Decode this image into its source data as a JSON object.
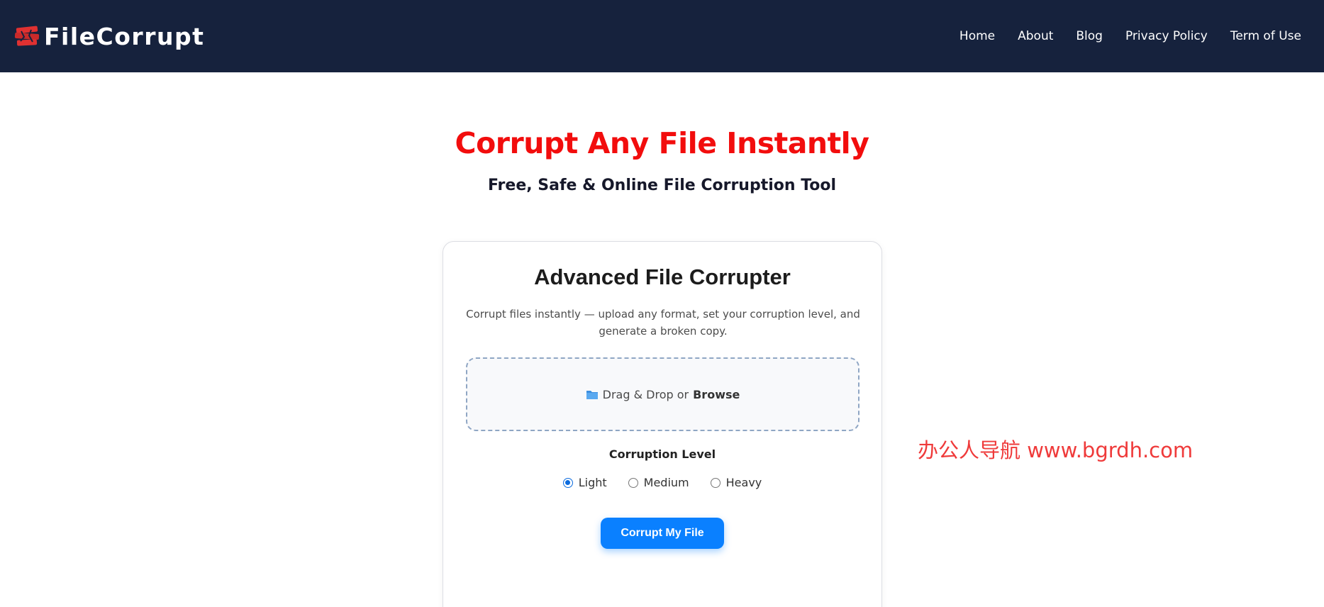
{
  "header": {
    "brand": "FileCorrupt",
    "nav": [
      {
        "label": "Home"
      },
      {
        "label": "About"
      },
      {
        "label": "Blog"
      },
      {
        "label": "Privacy Policy"
      },
      {
        "label": "Term of Use"
      }
    ]
  },
  "hero": {
    "title": "Corrupt Any File Instantly",
    "subtitle": "Free, Safe & Online File Corruption Tool"
  },
  "card": {
    "title": "Advanced File Corrupter",
    "description": "Corrupt files instantly — upload any format, set your corruption level, and generate a broken copy.",
    "dropzone": {
      "icon": "folder-icon",
      "text": "Drag & Drop or",
      "link": "Browse"
    },
    "corruption_level": {
      "label": "Corruption Level",
      "options": [
        "Light",
        "Medium",
        "Heavy"
      ],
      "selected": "Light"
    },
    "button_label": "Corrupt My File"
  },
  "watermark": "办公人导航 www.bgrdh.com",
  "colors": {
    "navbar": "#16223d",
    "title_red": "#f20d0d",
    "button_blue": "#0a80ff",
    "watermark_red": "#ef3a3a"
  }
}
